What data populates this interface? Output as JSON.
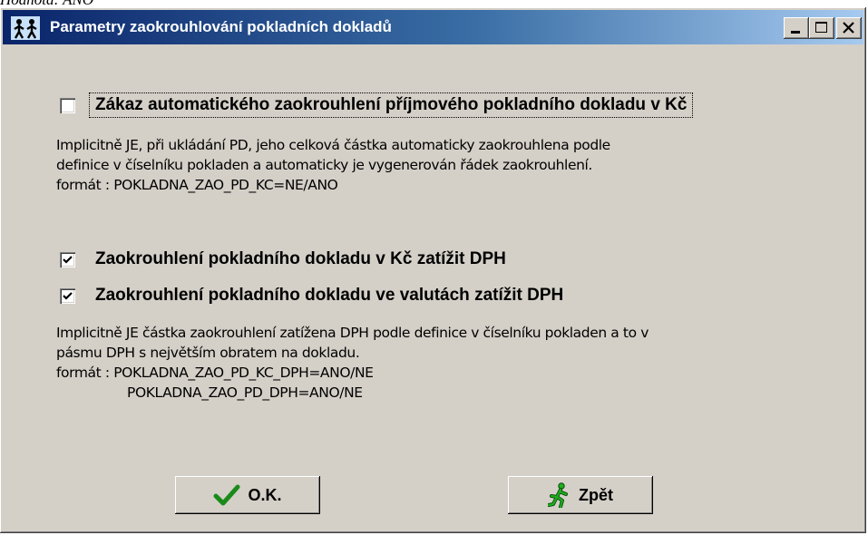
{
  "above_text": "Hodnota: ANO",
  "window": {
    "title": "Parametry zaokrouhlování pokladních dokladů",
    "buttons": {
      "minimize": "minimize",
      "maximize": "maximize",
      "close": "close"
    }
  },
  "options": [
    {
      "label": "Zákaz automatického zaokrouhlení příjmového pokladního dokladu v Kč",
      "checked": false
    },
    {
      "label": "Zaokrouhlení pokladního dokladu v Kč zatížit DPH",
      "checked": true
    },
    {
      "label": "Zaokrouhlení pokladního dokladu ve valutách zatížit DPH",
      "checked": true
    }
  ],
  "desc1": [
    "Implicitně JE, při ukládání PD, jeho celková částka automaticky zaokrouhlena podle",
    "definice v číselníku pokladen a automaticky je vygenerován řádek zaokrouhlení.",
    "formát : POKLADNA_ZAO_PD_KC=NE/ANO"
  ],
  "desc2": [
    "Implicitně JE částka zaokrouhlení zatížena DPH podle definice v číselníku pokladen a to v",
    "pásmu DPH s největším obratem na dokladu.",
    "formát : POKLADNA_ZAO_PD_KC_DPH=ANO/NE",
    "POKLADNA_ZAO_PD_DPH=ANO/NE"
  ],
  "buttons": {
    "ok": "O.K.",
    "back": "Zpět"
  },
  "colors": {
    "window_bg": "#d4d0c8",
    "title_from": "#0a246a",
    "title_to": "#a6caf0",
    "ok_check": "#1a8a1a",
    "back_figure": "#1fae1f"
  },
  "icons": {
    "title": "app-icon",
    "ok": "checkmark-icon",
    "back": "running-man-icon"
  }
}
